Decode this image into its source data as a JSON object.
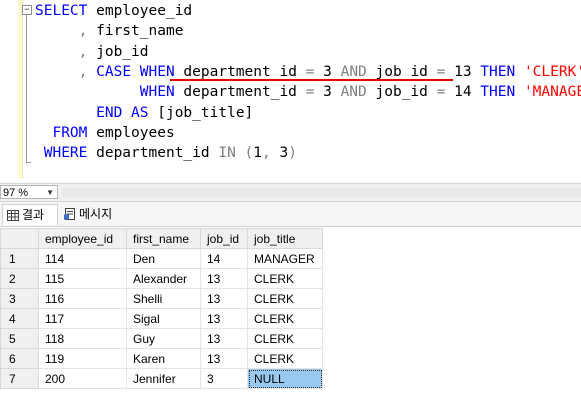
{
  "editor": {
    "lines": [
      {
        "indent": "",
        "parts": [
          [
            "kw",
            "SELECT"
          ],
          [
            "plain",
            " employee_id"
          ]
        ]
      },
      {
        "indent": "     ",
        "parts": [
          [
            "gray",
            ","
          ],
          [
            "plain",
            " first_name"
          ]
        ]
      },
      {
        "indent": "     ",
        "parts": [
          [
            "gray",
            ","
          ],
          [
            "plain",
            " job_id"
          ]
        ]
      },
      {
        "indent": "     ",
        "parts": [
          [
            "gray",
            ","
          ],
          [
            "plain",
            " "
          ],
          [
            "kw",
            "CASE"
          ],
          [
            "plain",
            " "
          ],
          [
            "kw",
            "WHEN"
          ],
          [
            "plain",
            " department_id "
          ],
          [
            "gray",
            "="
          ],
          [
            "plain",
            " 3 "
          ],
          [
            "gray",
            "AND"
          ],
          [
            "plain",
            " job_id "
          ],
          [
            "gray",
            "="
          ],
          [
            "plain",
            " 13 "
          ],
          [
            "kw",
            "THEN"
          ],
          [
            "plain",
            " "
          ],
          [
            "str",
            "'CLERK'"
          ]
        ]
      },
      {
        "indent": "            ",
        "parts": [
          [
            "kw",
            "WHEN"
          ],
          [
            "plain",
            " department_id "
          ],
          [
            "gray",
            "="
          ],
          [
            "plain",
            " 3 "
          ],
          [
            "gray",
            "AND"
          ],
          [
            "plain",
            " job_id "
          ],
          [
            "gray",
            "="
          ],
          [
            "plain",
            " 14 "
          ],
          [
            "kw",
            "THEN"
          ],
          [
            "plain",
            " "
          ],
          [
            "str",
            "'MANAGER'"
          ]
        ]
      },
      {
        "indent": "       ",
        "parts": [
          [
            "kw",
            "END"
          ],
          [
            "plain",
            " "
          ],
          [
            "kw",
            "AS"
          ],
          [
            "plain",
            " [job_title]"
          ]
        ]
      },
      {
        "indent": "  ",
        "parts": [
          [
            "kw",
            "FROM"
          ],
          [
            "plain",
            " employees"
          ]
        ]
      },
      {
        "indent": " ",
        "parts": [
          [
            "kw",
            "WHERE"
          ],
          [
            "plain",
            " department_id "
          ],
          [
            "gray",
            "IN"
          ],
          [
            "plain",
            " "
          ],
          [
            "gray",
            "("
          ],
          [
            "plain",
            "1"
          ],
          [
            "gray",
            ","
          ],
          [
            "plain",
            " 3"
          ],
          [
            "gray",
            ")"
          ]
        ]
      }
    ]
  },
  "status": {
    "zoom": "97 %"
  },
  "tabs": {
    "results_label": "결과",
    "messages_label": "메시지"
  },
  "grid": {
    "columns": [
      "employee_id",
      "first_name",
      "job_id",
      "job_title"
    ],
    "rows": [
      {
        "num": "1",
        "cells": [
          "114",
          "Den",
          "14",
          "MANAGER"
        ]
      },
      {
        "num": "2",
        "cells": [
          "115",
          "Alexander",
          "13",
          "CLERK"
        ]
      },
      {
        "num": "3",
        "cells": [
          "116",
          "Shelli",
          "13",
          "CLERK"
        ]
      },
      {
        "num": "4",
        "cells": [
          "117",
          "Sigal",
          "13",
          "CLERK"
        ]
      },
      {
        "num": "5",
        "cells": [
          "118",
          "Guy",
          "13",
          "CLERK"
        ]
      },
      {
        "num": "6",
        "cells": [
          "119",
          "Karen",
          "13",
          "CLERK"
        ]
      },
      {
        "num": "7",
        "cells": [
          "200",
          "Jennifer",
          "3",
          "NULL"
        ]
      }
    ],
    "selected_cell_color": "#99c9ef"
  },
  "colors": {
    "keyword": "#0000ff",
    "operator": "#808080",
    "string": "#ff0000",
    "annotation": "#e00000"
  }
}
